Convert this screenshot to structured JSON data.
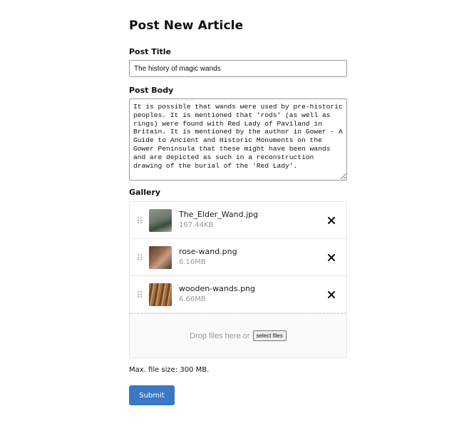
{
  "page_title": "Post New Article",
  "post_title": {
    "label": "Post Title",
    "value": "The history of magic wands"
  },
  "post_body": {
    "label": "Post Body",
    "value": "It is possible that wands were used by pre-historic peoples. It is mentioned that 'rods' (as well as rings) were found with Red Lady of Paviland in Britain. It is mentioned by the author in Gower - A Guide to Ancient and Historic Monuments on the Gower Peninsula that these might have been wands and are depicted as such in a reconstruction drawing of the burial of the 'Red Lady'."
  },
  "gallery": {
    "label": "Gallery",
    "items": [
      {
        "name": "The_Elder_Wand.jpg",
        "size": "167.44KB",
        "remove_glyph": "✕"
      },
      {
        "name": "rose-wand.png",
        "size": "6.16MB",
        "remove_glyph": "✕"
      },
      {
        "name": "wooden-wands.png",
        "size": "6.66MB",
        "remove_glyph": "✕"
      }
    ],
    "dropzone_text": "Drop files here or",
    "select_button": "select files"
  },
  "max_file_size": "Max. file size: 300 MB.",
  "submit_label": "Submit",
  "colors": {
    "submit_bg": "#3a78c3",
    "muted_text": "#9a9a9a"
  }
}
